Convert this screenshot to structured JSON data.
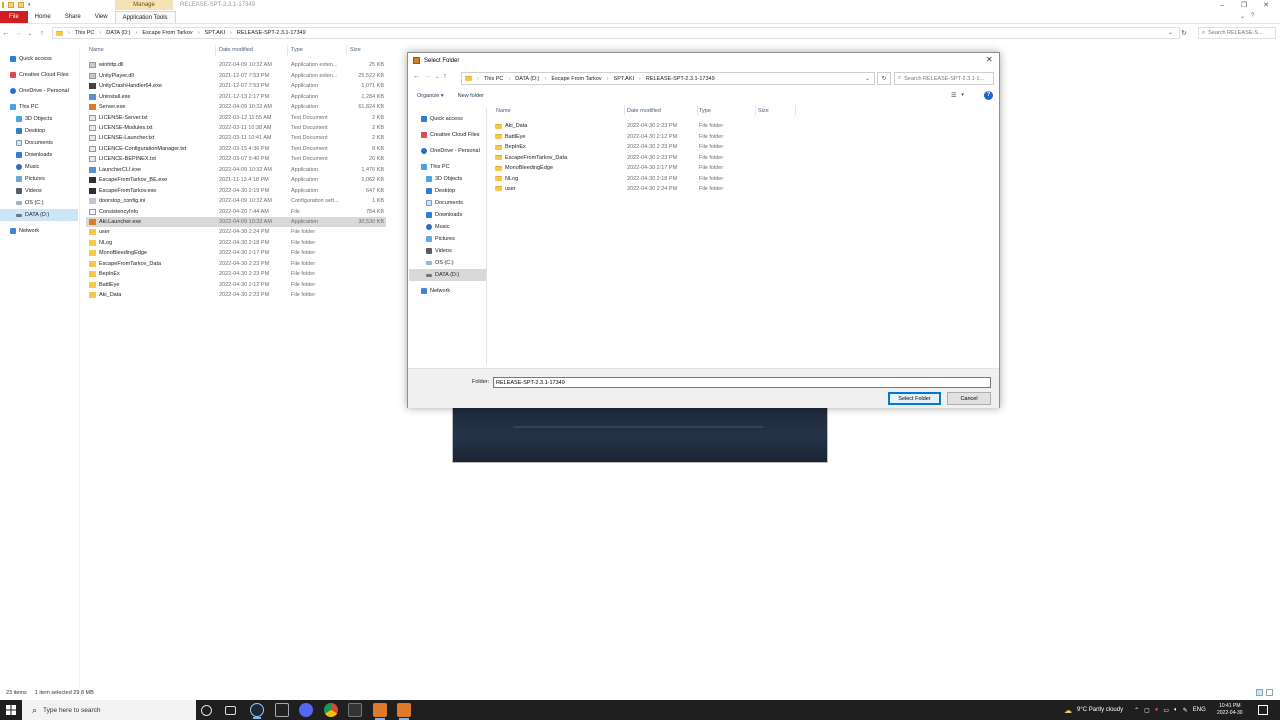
{
  "explorer": {
    "window_title": "RELEASE-SPT-2.3.1-17349",
    "manage_label": "Manage",
    "ribbon_tabs": [
      "File",
      "Home",
      "Share",
      "View",
      "Application Tools"
    ],
    "breadcrumb": [
      "This PC",
      "DATA (D:)",
      "Escape From Tarkov",
      "SPT.AKI",
      "RELEASE-SPT-2.3.1-17349"
    ],
    "search_placeholder": "Search RELEASE-S...",
    "nav": [
      {
        "label": "Quick access",
        "icon": "star-icon"
      },
      {
        "label": "Creative Cloud Files",
        "icon": "creative-cloud-icon"
      },
      {
        "label": "OneDrive - Personal",
        "icon": "cloud-icon"
      },
      {
        "label": "This PC",
        "icon": "computer-icon"
      },
      {
        "label": "3D Objects",
        "icon": "cube-icon"
      },
      {
        "label": "Desktop",
        "icon": "desktop-icon"
      },
      {
        "label": "Documents",
        "icon": "document-icon"
      },
      {
        "label": "Downloads",
        "icon": "download-icon"
      },
      {
        "label": "Music",
        "icon": "music-icon"
      },
      {
        "label": "Pictures",
        "icon": "picture-icon"
      },
      {
        "label": "Videos",
        "icon": "video-icon"
      },
      {
        "label": "OS (C:)",
        "icon": "drive-icon"
      },
      {
        "label": "DATA (D:)",
        "icon": "drive-icon"
      },
      {
        "label": "Network",
        "icon": "network-icon"
      }
    ],
    "columns": {
      "name": "Name",
      "date": "Date modified",
      "type": "Type",
      "size": "Size"
    },
    "files": [
      {
        "name": "winhttp.dll",
        "date": "2022-04-09 10:32 AM",
        "type": "Application exten...",
        "size": "25 KB",
        "icon": "dll-icon"
      },
      {
        "name": "UnityPlayer.dll",
        "date": "2021-12-07 7:53 PM",
        "type": "Application exten...",
        "size": "25,522 KB",
        "icon": "dll-icon"
      },
      {
        "name": "UnityCrashHandler64.exe",
        "date": "2021-12-07 7:53 PM",
        "type": "Application",
        "size": "1,071 KB",
        "icon": "unity-icon"
      },
      {
        "name": "Uninstall.exe",
        "date": "2021-12-13 2:17 PM",
        "type": "Application",
        "size": "1,284 KB",
        "icon": "exe-icon"
      },
      {
        "name": "Server.exe",
        "date": "2022-04-09 10:32 AM",
        "type": "Application",
        "size": "61,824 KB",
        "icon": "server-icon"
      },
      {
        "name": "LICENSE-Server.txt",
        "date": "2022-03-12 11:55 AM",
        "type": "Text Document",
        "size": "2 KB",
        "icon": "text-file-icon"
      },
      {
        "name": "LICENSE-Modules.txt",
        "date": "2022-03-11 10:38 AM",
        "type": "Text Document",
        "size": "2 KB",
        "icon": "text-file-icon"
      },
      {
        "name": "LICENSE-Launcher.txt",
        "date": "2022-03-11 10:41 AM",
        "type": "Text Document",
        "size": "2 KB",
        "icon": "text-file-icon"
      },
      {
        "name": "LICENCE-ConfigurationManager.txt",
        "date": "2022-03-15 4:36 PM",
        "type": "Text Document",
        "size": "8 KB",
        "icon": "text-file-icon"
      },
      {
        "name": "LICENCE-BEPINEX.txt",
        "date": "2022-03-07 9:40 PM",
        "type": "Text Document",
        "size": "26 KB",
        "icon": "text-file-icon"
      },
      {
        "name": "LauncherCLI.exe",
        "date": "2022-04-09 10:32 AM",
        "type": "Application",
        "size": "1,476 KB",
        "icon": "exe-icon"
      },
      {
        "name": "EscapeFromTarkov_BE.exe",
        "date": "2021-11-13 4:18 PM",
        "type": "Application",
        "size": "1,062 KB",
        "icon": "tarkov-icon"
      },
      {
        "name": "EscapeFromTarkov.exe",
        "date": "2022-04-30 2:19 PM",
        "type": "Application",
        "size": "647 KB",
        "icon": "tarkov-icon"
      },
      {
        "name": "doorstop_config.ini",
        "date": "2022-04-09 10:32 AM",
        "type": "Configuration sett...",
        "size": "1 KB",
        "icon": "config-file-icon"
      },
      {
        "name": "ConsistencyInfo",
        "date": "2022-04-20 7:44 AM",
        "type": "File",
        "size": "784 KB",
        "icon": "file-icon"
      },
      {
        "name": "Aki.Launcher.exe",
        "date": "2022-04-09 10:32 AM",
        "type": "Application",
        "size": "30,530 KB",
        "icon": "launcher-icon",
        "selected": true
      },
      {
        "name": "user",
        "date": "2022-04-30 2:24 PM",
        "type": "File folder",
        "size": "",
        "icon": "folder-icon"
      },
      {
        "name": "NLog",
        "date": "2022-04-30 2:18 PM",
        "type": "File folder",
        "size": "",
        "icon": "folder-icon"
      },
      {
        "name": "MonoBleedingEdge",
        "date": "2022-04-30 2:17 PM",
        "type": "File folder",
        "size": "",
        "icon": "folder-icon"
      },
      {
        "name": "EscapeFromTarkov_Data",
        "date": "2022-04-30 2:23 PM",
        "type": "File folder",
        "size": "",
        "icon": "folder-icon"
      },
      {
        "name": "BepInEx",
        "date": "2022-04-30 2:23 PM",
        "type": "File folder",
        "size": "",
        "icon": "folder-icon"
      },
      {
        "name": "BattlEye",
        "date": "2022-04-30 2:12 PM",
        "type": "File folder",
        "size": "",
        "icon": "folder-icon"
      },
      {
        "name": "Aki_Data",
        "date": "2022-04-30 2:23 PM",
        "type": "File folder",
        "size": "",
        "icon": "folder-icon"
      }
    ],
    "status": {
      "count": "23 items",
      "selection": "1 item selected  29.8 MB"
    }
  },
  "dialog": {
    "title": "Select Folder",
    "breadcrumb": [
      "This PC",
      "DATA (D:)",
      "Escape From Tarkov",
      "SPT.AKI",
      "RELEASE-SPT-2.3.1-17349"
    ],
    "search_placeholder": "Search RELEASE-SPT-2.3.1-1...",
    "organize": "Organize ▾",
    "new_folder": "New folder",
    "nav": [
      {
        "label": "Quick access",
        "icon": "star-icon"
      },
      {
        "label": "Creative Cloud Files",
        "icon": "creative-cloud-icon"
      },
      {
        "label": "OneDrive - Personal",
        "icon": "cloud-icon"
      },
      {
        "label": "This PC",
        "icon": "computer-icon"
      },
      {
        "label": "3D Objects",
        "icon": "cube-icon"
      },
      {
        "label": "Desktop",
        "icon": "desktop-icon"
      },
      {
        "label": "Documents",
        "icon": "document-icon"
      },
      {
        "label": "Downloads",
        "icon": "download-icon"
      },
      {
        "label": "Music",
        "icon": "music-icon"
      },
      {
        "label": "Pictures",
        "icon": "picture-icon"
      },
      {
        "label": "Videos",
        "icon": "video-icon"
      },
      {
        "label": "OS (C:)",
        "icon": "drive-icon"
      },
      {
        "label": "DATA (D:)",
        "icon": "drive-icon"
      },
      {
        "label": "Network",
        "icon": "network-icon"
      }
    ],
    "columns": {
      "name": "Name",
      "date": "Date modified",
      "type": "Type",
      "size": "Size"
    },
    "folders": [
      {
        "name": "Aki_Data",
        "date": "2022-04-30 2:23 PM",
        "type": "File folder"
      },
      {
        "name": "BattlEye",
        "date": "2022-04-30 2:12 PM",
        "type": "File folder"
      },
      {
        "name": "BepInEx",
        "date": "2022-04-30 2:23 PM",
        "type": "File folder"
      },
      {
        "name": "EscapeFromTarkov_Data",
        "date": "2022-04-30 2:23 PM",
        "type": "File folder"
      },
      {
        "name": "MonoBleedingEdge",
        "date": "2022-04-30 2:17 PM",
        "type": "File folder"
      },
      {
        "name": "NLog",
        "date": "2022-04-30 2:18 PM",
        "type": "File folder"
      },
      {
        "name": "user",
        "date": "2022-04-30 2:24 PM",
        "type": "File folder"
      }
    ],
    "folder_label": "Folder:",
    "folder_value": "RELEASE-SPT-2.3.1-17349",
    "select_button": "Select Folder",
    "cancel_button": "Cancel"
  },
  "taskbar": {
    "search_placeholder": "Type here to search",
    "weather": "9°C  Partly cloudy",
    "language": "ENG",
    "time": "10:41 PM",
    "date": "2022-04-30",
    "apps": [
      "task-view-icon",
      "widgets-icon",
      "steam-icon",
      "terminal-icon",
      "discord-icon",
      "chrome-icon",
      "tarkov-icon",
      "launcher-icon",
      "launcher-icon"
    ]
  },
  "colors": {
    "file_tab": "#cf1f1f",
    "manage_tab": "#f3e3b5",
    "selection": "#cde6f7",
    "taskbar": "#1f1f1f",
    "accent": "#0078d7"
  }
}
